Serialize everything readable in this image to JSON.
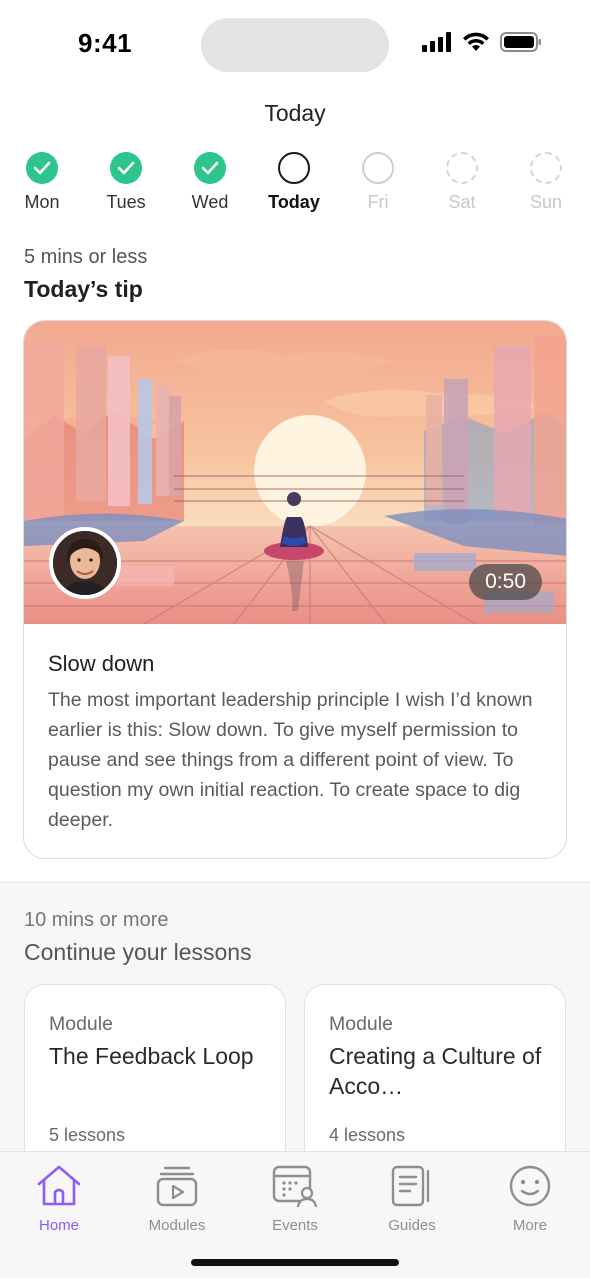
{
  "status_bar": {
    "time": "9:41"
  },
  "header": {
    "title": "Today"
  },
  "week": [
    {
      "label": "Mon",
      "state": "done"
    },
    {
      "label": "Tues",
      "state": "done"
    },
    {
      "label": "Wed",
      "state": "done"
    },
    {
      "label": "Today",
      "state": "today"
    },
    {
      "label": "Fri",
      "state": "future"
    },
    {
      "label": "Sat",
      "state": "future-dashed"
    },
    {
      "label": "Sun",
      "state": "future-dashed"
    }
  ],
  "tip_section": {
    "kicker": "5 mins or less",
    "title": "Today’s tip",
    "card": {
      "duration": "0:50",
      "title": "Slow down",
      "body": "The most important leadership principle I wish I’d known earlier is this: Slow down. To give myself permission to pause and see things from a different point of view. To question my own initial reaction. To create space to dig deeper."
    }
  },
  "lessons_section": {
    "kicker": "10 mins or more",
    "title": "Continue your lessons",
    "modules": [
      {
        "kicker": "Module",
        "name": "The Feedback Loop",
        "lessons": "5 lessons"
      },
      {
        "kicker": "Module",
        "name": "Creating a Culture of Acco…",
        "lessons": "4 lessons"
      }
    ]
  },
  "tab_bar": {
    "tabs": [
      {
        "label": "Home",
        "icon": "home-icon",
        "active": true
      },
      {
        "label": "Modules",
        "icon": "modules-icon",
        "active": false
      },
      {
        "label": "Events",
        "icon": "events-icon",
        "active": false
      },
      {
        "label": "Guides",
        "icon": "guides-icon",
        "active": false
      },
      {
        "label": "More",
        "icon": "more-icon",
        "active": false
      }
    ]
  },
  "colors": {
    "accent": "#8b5cf6",
    "done": "#2ec48e"
  }
}
